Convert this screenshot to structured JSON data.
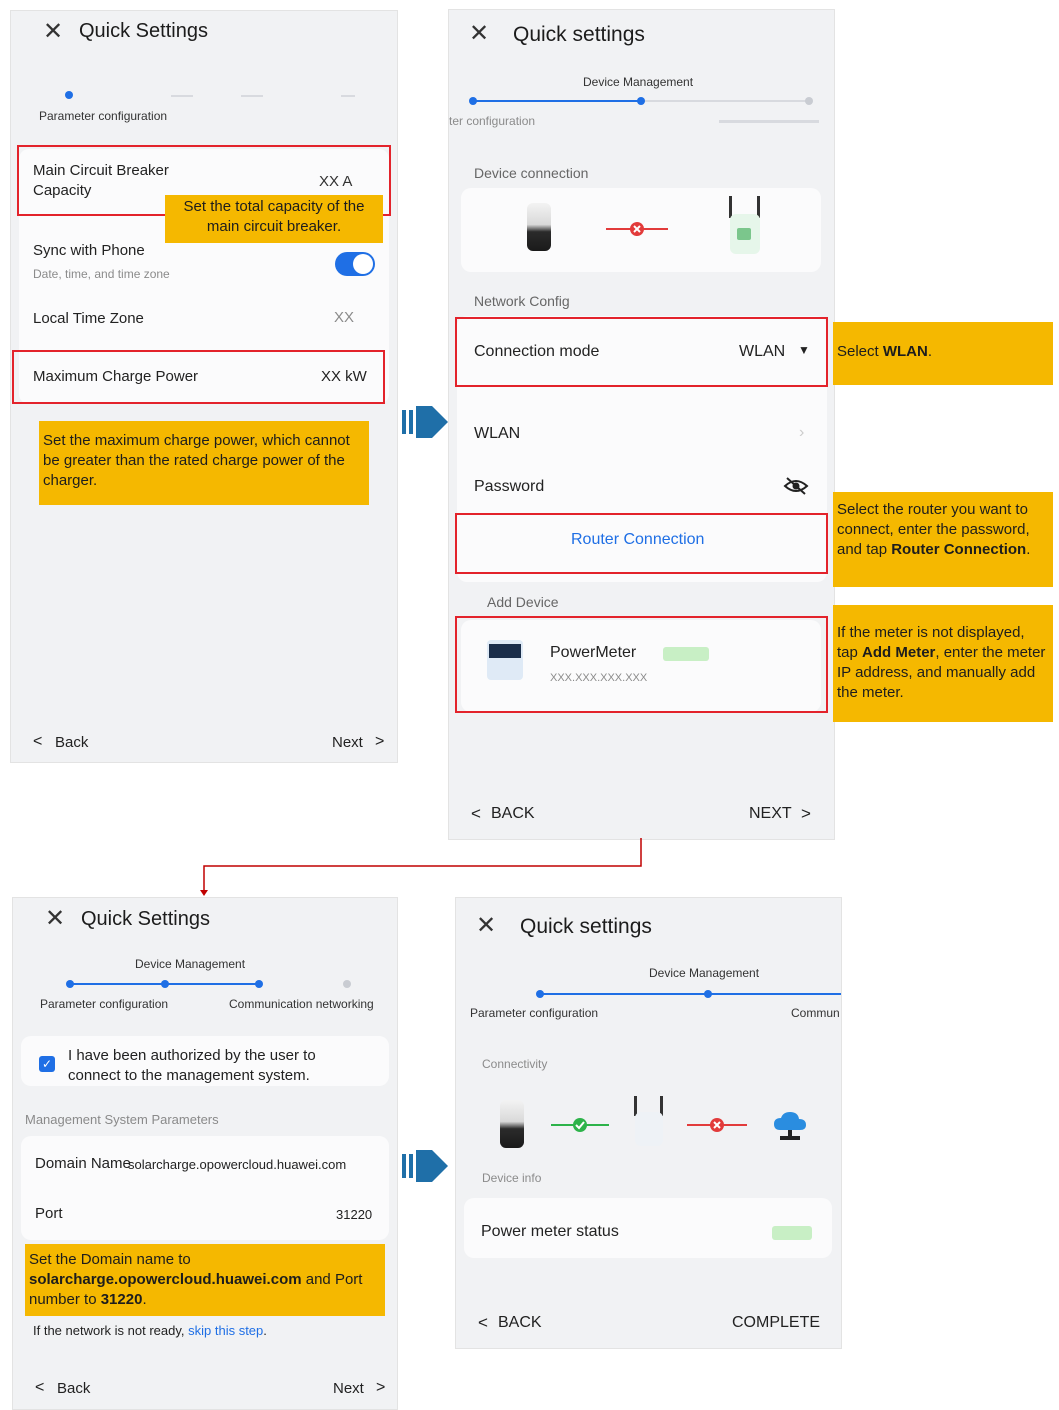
{
  "colors": {
    "accent": "#1f6fe5",
    "highlight": "#e3232b",
    "note": "#f5b800",
    "success": "#2db34a",
    "error": "#e23b3b",
    "flow_arrow": "#1f6fa8",
    "connector": "#c00000"
  },
  "s1": {
    "title": "Quick Settings",
    "step": "Parameter configuration",
    "main_breaker_label": "Main Circuit Breaker Capacity",
    "main_breaker_value": "XX A",
    "note_breaker": "Set the total capacity of the main circuit breaker.",
    "sync_label": "Sync with Phone",
    "sync_sub": "Date, time, and time zone",
    "timezone_label": "Local Time Zone",
    "timezone_value": "XX",
    "max_power_label": "Maximum Charge Power",
    "max_power_value": "XX kW",
    "note_power": "Set the maximum charge power, which cannot be greater than the rated charge power of the charger.",
    "back": "Back",
    "next": "Next"
  },
  "s2": {
    "title": "Quick settings",
    "step_center": "Device Management",
    "step_left": "ter configuration",
    "section_device": "Device connection",
    "section_network": "Network Config",
    "conn_mode_label": "Connection mode",
    "conn_mode_value": "WLAN",
    "wlan_label": "WLAN",
    "password_label": "Password",
    "router_btn": "Router Connection",
    "section_add": "Add Device",
    "meter_name": "PowerMeter",
    "meter_ip": "XXX.XXX.XXX.XXX",
    "back": "BACK",
    "next": "NEXT"
  },
  "notes2": {
    "wlan_pre": "Select ",
    "wlan_bold": "WLAN",
    "wlan_post": ".",
    "router_pre": "Select the router you want to connect, enter the password, and tap ",
    "router_bold": "Router Connection",
    "router_post": ".",
    "meter_pre": "If the meter is not displayed, tap ",
    "meter_bold": "Add Meter",
    "meter_post": ", enter the meter IP address, and manually add the meter."
  },
  "s3": {
    "title": "Quick Settings",
    "step_center": "Device Management",
    "step_left": "Parameter configuration",
    "step_right": "Communication networking",
    "auth_text": "I have been authorized by the user to connect to the management system.",
    "section_params": "Management System Parameters",
    "domain_label": "Domain Name",
    "domain_value": "solarcharge.opowercloud.huawei.com",
    "port_label": "Port",
    "port_value": "31220",
    "note_pre": "Set the Domain name to ",
    "note_domain": "solarcharge.opowercloud.huawei.com",
    "note_mid": " and Port number to ",
    "note_port": "31220",
    "note_post": ".",
    "skip_pre": "If the network is not ready, ",
    "skip_link": "skip this step",
    "skip_post": ".",
    "back": "Back",
    "next": "Next"
  },
  "s4": {
    "title": "Quick settings",
    "step_center": "Device Management",
    "step_left": "Parameter configuration",
    "step_right": "Commun",
    "section_conn": "Connectivity",
    "section_info": "Device info",
    "meter_status_label": "Power meter status",
    "back": "BACK",
    "complete": "COMPLETE"
  },
  "icons": [
    "close-icon",
    "chevron-left-icon",
    "chevron-right-icon",
    "toggle-switch",
    "phone-icon",
    "dongle-icon",
    "cloud-icon",
    "eye-off-icon",
    "checkbox-icon",
    "flow-arrow-icon",
    "dropdown-caret-icon"
  ]
}
